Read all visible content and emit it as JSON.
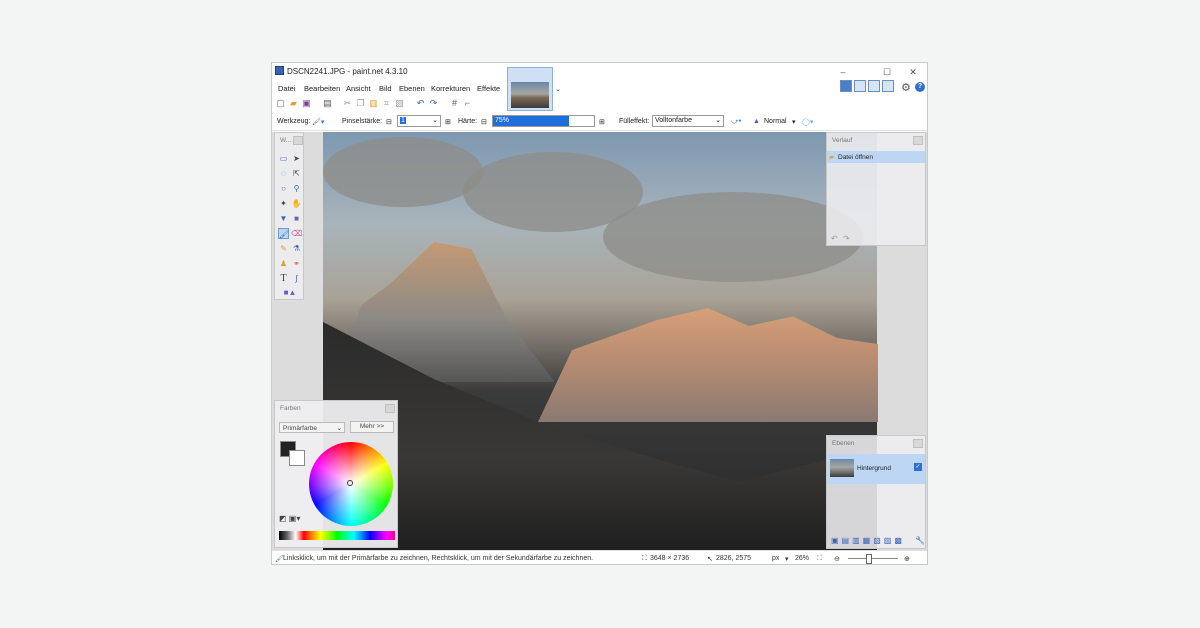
{
  "window": {
    "title": "DSCN2241.JPG - paint.net 4.3.10",
    "buttons": {
      "minimize": "–",
      "maximize": "☐",
      "close": "✕"
    }
  },
  "menu": [
    "Datei",
    "Bearbeiten",
    "Ansicht",
    "Bild",
    "Ebenen",
    "Korrekturen",
    "Effekte"
  ],
  "toolbar": {
    "tool_label": "Werkzeug:",
    "brush_label": "Pinselstärke:",
    "brush_value": "1",
    "hardness_label": "Härte:",
    "hardness_value": "75%",
    "hardness_fraction": 0.75,
    "fill_label": "Fülleffekt:",
    "fill_value": "Volltonfarbe",
    "blend_value": "Normal"
  },
  "panels": {
    "tools_title": "W...",
    "history_title": "Verlauf",
    "history_item": "Datei öffnen",
    "layers_title": "Ebenen",
    "layer_name": "Hintergrund",
    "colors_title": "Farben",
    "color_mode": "Primärfarbe",
    "more_button": "Mehr >>"
  },
  "status": {
    "hint": "Linksklick, um mit der Primärfarbe zu zeichnen, Rechtsklick, um mit der Sekundärfarbe zu zeichnen.",
    "image_size": "3648 × 2736",
    "cursor_pos": "2826, 2575",
    "unit": "px",
    "zoom": "26%"
  },
  "colors": {
    "accent": "#1e6fd9",
    "selection": "#bcd6f3"
  }
}
